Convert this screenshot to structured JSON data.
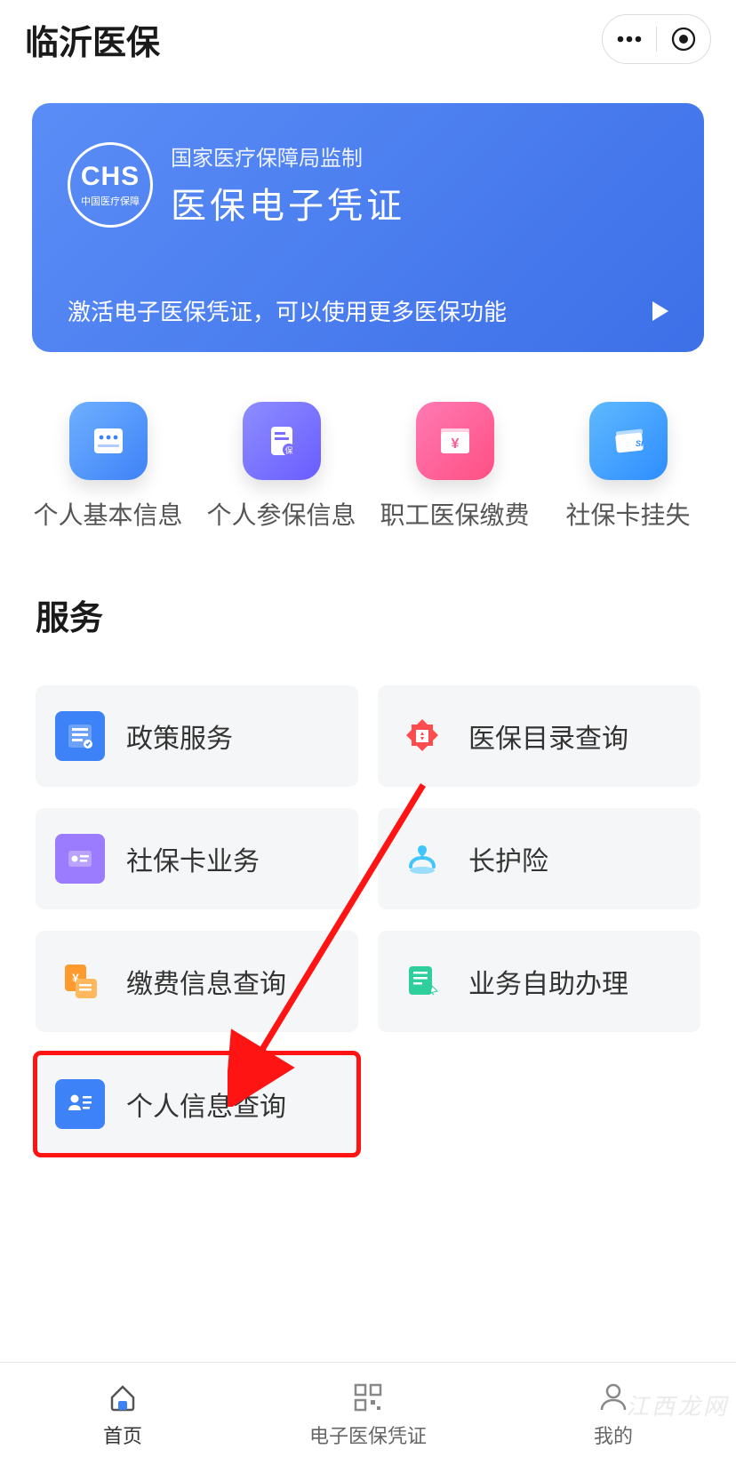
{
  "header": {
    "title": "临沂医保"
  },
  "hero": {
    "badge_label": "CHS",
    "badge_sub": "中国医疗保障",
    "subtitle": "国家医疗保障局监制",
    "title": "医保电子凭证",
    "cta": "激活电子医保凭证，可以使用更多医保功能"
  },
  "quick_actions": [
    {
      "label": "个人基本信息",
      "icon": "info-card",
      "bg": "linear-gradient(135deg,#6fb0ff,#3e82f7)"
    },
    {
      "label": "个人参保信息",
      "icon": "policy-doc",
      "bg": "linear-gradient(135deg,#8d8eff,#6a5cff)"
    },
    {
      "label": "职工医保缴费",
      "icon": "rmb-wallet",
      "bg": "linear-gradient(135deg,#ff7ab3,#ff4f84)"
    },
    {
      "label": "社保卡挂失",
      "icon": "card-loss",
      "bg": "linear-gradient(135deg,#5fb9ff,#2e8dff)"
    }
  ],
  "services": {
    "title": "服务",
    "items": [
      {
        "label": "政策服务",
        "icon": "policy",
        "color": "#3e82f7"
      },
      {
        "label": "医保目录查询",
        "icon": "catalog",
        "color": "#ff4d4f"
      },
      {
        "label": "社保卡业务",
        "icon": "social-card",
        "color": "#9b7cff"
      },
      {
        "label": "长护险",
        "icon": "care",
        "color": "#41c5ff"
      },
      {
        "label": "缴费信息查询",
        "icon": "payment",
        "color": "#ff9a2e"
      },
      {
        "label": "业务自助办理",
        "icon": "self-serve",
        "color": "#2ecf9a"
      },
      {
        "label": "个人信息查询",
        "icon": "profile",
        "color": "#3e82f7",
        "highlighted": true
      }
    ]
  },
  "tabbar": [
    {
      "label": "首页",
      "icon": "home",
      "active": true
    },
    {
      "label": "电子医保凭证",
      "icon": "qrcode",
      "active": false
    },
    {
      "label": "我的",
      "icon": "me",
      "active": false
    }
  ],
  "watermark": "江西龙网"
}
